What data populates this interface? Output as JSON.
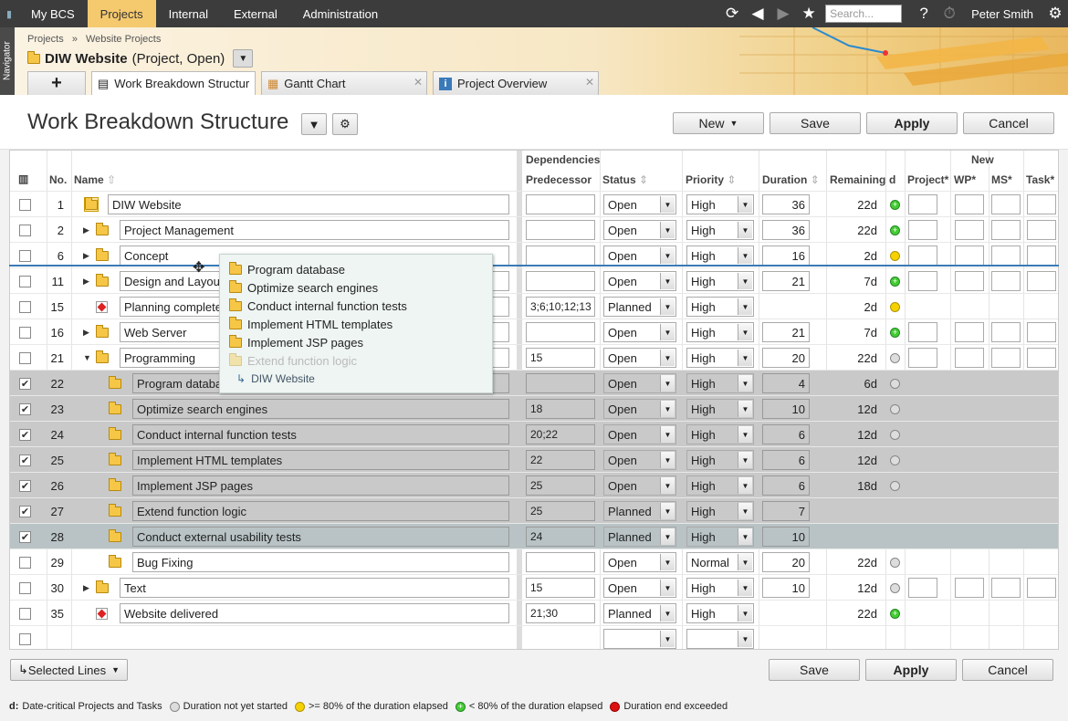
{
  "topbar": {
    "nav": [
      "My BCS",
      "Projects",
      "Internal",
      "External",
      "Administration"
    ],
    "active_nav": 1,
    "search_placeholder": "Search...",
    "help": "?",
    "user": "Peter Smith"
  },
  "navigator_label": "Navigator",
  "header": {
    "breadcrumb_1": "Projects",
    "breadcrumb_sep": "»",
    "breadcrumb_2": "Website Projects",
    "project_name": "DIW Website",
    "project_meta": "(Project, Open)",
    "add_tab": "+",
    "tabs": [
      {
        "label": "Work Breakdown Structure",
        "active": true
      },
      {
        "label": "Gantt Chart",
        "active": false
      },
      {
        "label": "Project Overview",
        "active": false
      }
    ]
  },
  "toolbar": {
    "title": "Work Breakdown Structure",
    "new_label": "New",
    "save_label": "Save",
    "apply_label": "Apply",
    "cancel_label": "Cancel"
  },
  "grid": {
    "group_dependencies": "Dependencies",
    "group_new": "New",
    "columns": {
      "no": "No.",
      "name": "Name",
      "predecessor": "Predecessor",
      "status": "Status",
      "priority": "Priority",
      "duration": "Duration",
      "remaining": "Remaining",
      "d": "d",
      "project": "Project*",
      "wp": "WP*",
      "ms": "MS*",
      "task": "Task*"
    },
    "rows": [
      {
        "no": "1",
        "name": "DIW Website",
        "pred": "",
        "status": "Open",
        "priority": "High",
        "duration": "36",
        "remaining": "22d",
        "dot": "green",
        "checked": false,
        "indent": 0,
        "icon": "folder-open",
        "tri": "",
        "newcols": true
      },
      {
        "no": "2",
        "name": "Project Management",
        "pred": "",
        "status": "Open",
        "priority": "High",
        "duration": "36",
        "remaining": "22d",
        "dot": "green",
        "checked": false,
        "indent": 1,
        "icon": "folder",
        "tri": "right",
        "newcols": true
      },
      {
        "no": "6",
        "name": "Concept",
        "pred": "",
        "status": "Open",
        "priority": "High",
        "duration": "16",
        "remaining": "2d",
        "dot": "yellow",
        "checked": false,
        "indent": 1,
        "icon": "folder",
        "tri": "right",
        "newcols": true
      },
      {
        "no": "11",
        "name": "Design and Layout",
        "pred": "",
        "status": "Open",
        "priority": "High",
        "duration": "21",
        "remaining": "7d",
        "dot": "green",
        "checked": false,
        "indent": 1,
        "icon": "folder",
        "tri": "right",
        "newcols": true
      },
      {
        "no": "15",
        "name": "Planning completed",
        "pred": "3;6;10;12;13",
        "status": "Planned",
        "priority": "High",
        "duration": "",
        "remaining": "2d",
        "dot": "yellow",
        "checked": false,
        "indent": 1,
        "icon": "milestone",
        "tri": "",
        "newcols": false
      },
      {
        "no": "16",
        "name": "Web Server",
        "pred": "",
        "status": "Open",
        "priority": "High",
        "duration": "21",
        "remaining": "7d",
        "dot": "green",
        "checked": false,
        "indent": 1,
        "icon": "folder",
        "tri": "right",
        "newcols": true
      },
      {
        "no": "21",
        "name": "Programming",
        "pred": "15",
        "status": "Open",
        "priority": "High",
        "duration": "20",
        "remaining": "22d",
        "dot": "grey",
        "checked": false,
        "indent": 1,
        "icon": "folder",
        "tri": "down",
        "newcols": true
      },
      {
        "no": "22",
        "name": "Program database",
        "pred": "",
        "status": "Open",
        "priority": "High",
        "duration": "4",
        "remaining": "6d",
        "dot": "grey",
        "checked": true,
        "indent": 2,
        "icon": "folder",
        "tri": "",
        "newcols": false
      },
      {
        "no": "23",
        "name": "Optimize search engines",
        "pred": "18",
        "status": "Open",
        "priority": "High",
        "duration": "10",
        "remaining": "12d",
        "dot": "grey",
        "checked": true,
        "indent": 2,
        "icon": "folder",
        "tri": "",
        "newcols": false
      },
      {
        "no": "24",
        "name": "Conduct internal function tests",
        "pred": "20;22",
        "status": "Open",
        "priority": "High",
        "duration": "6",
        "remaining": "12d",
        "dot": "grey",
        "checked": true,
        "indent": 2,
        "icon": "folder",
        "tri": "",
        "newcols": false
      },
      {
        "no": "25",
        "name": "Implement HTML templates",
        "pred": "22",
        "status": "Open",
        "priority": "High",
        "duration": "6",
        "remaining": "12d",
        "dot": "grey",
        "checked": true,
        "indent": 2,
        "icon": "folder",
        "tri": "",
        "newcols": false
      },
      {
        "no": "26",
        "name": "Implement JSP pages",
        "pred": "25",
        "status": "Open",
        "priority": "High",
        "duration": "6",
        "remaining": "18d",
        "dot": "grey",
        "checked": true,
        "indent": 2,
        "icon": "folder",
        "tri": "",
        "newcols": false
      },
      {
        "no": "27",
        "name": "Extend function logic",
        "pred": "25",
        "status": "Planned",
        "priority": "High",
        "duration": "7",
        "remaining": "",
        "dot": "",
        "checked": true,
        "indent": 2,
        "icon": "folder",
        "tri": "",
        "newcols": false
      },
      {
        "no": "28",
        "name": "Conduct external usability tests",
        "pred": "24",
        "status": "Planned",
        "priority": "High",
        "duration": "10",
        "remaining": "",
        "dot": "",
        "checked": true,
        "indent": 2,
        "icon": "folder",
        "tri": "",
        "newcols": false
      },
      {
        "no": "29",
        "name": "Bug Fixing",
        "pred": "",
        "status": "Open",
        "priority": "Normal",
        "duration": "20",
        "remaining": "22d",
        "dot": "grey",
        "checked": false,
        "indent": 2,
        "icon": "folder",
        "tri": "",
        "newcols": false
      },
      {
        "no": "30",
        "name": "Text",
        "pred": "15",
        "status": "Open",
        "priority": "High",
        "duration": "10",
        "remaining": "12d",
        "dot": "grey",
        "checked": false,
        "indent": 1,
        "icon": "folder",
        "tri": "right",
        "newcols": true
      },
      {
        "no": "35",
        "name": "Website delivered",
        "pred": "21;30",
        "status": "Planned",
        "priority": "High",
        "duration": "",
        "remaining": "22d",
        "dot": "green",
        "checked": false,
        "indent": 1,
        "icon": "milestone",
        "tri": "",
        "newcols": false
      }
    ]
  },
  "drag_popup": {
    "items": [
      "Program database",
      "Optimize search engines",
      "Conduct internal function tests",
      "Implement HTML templates",
      "Implement JSP pages",
      "Extend function logic"
    ],
    "target": "DIW Website"
  },
  "footer": {
    "selected_lines": "Selected Lines",
    "save_label": "Save",
    "apply_label": "Apply",
    "cancel_label": "Cancel"
  },
  "legend": {
    "prefix": "d:",
    "title": "Date-critical Projects and Tasks",
    "not_started": "Duration not yet started",
    "over80": ">= 80% of the duration elapsed",
    "under80": "< 80% of the duration elapsed",
    "exceeded": "Duration end exceeded"
  },
  "colors": {
    "accent": "#3a7ab8",
    "topbar": "#3c3c3c",
    "active_nav": "#f5c96e",
    "selected_row": "#c9c9c9"
  }
}
